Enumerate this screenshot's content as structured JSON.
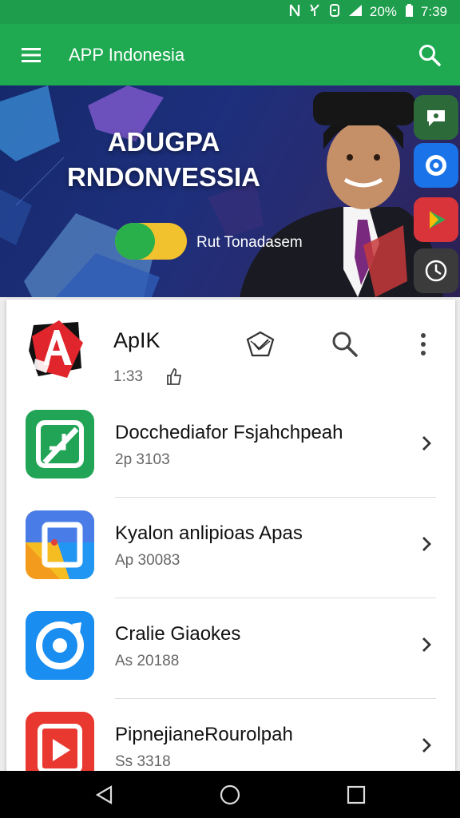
{
  "status_bar": {
    "battery_text": "20%",
    "time": "7:39",
    "icons": [
      "nfc-icon",
      "vibrate-icon",
      "alarm-icon",
      "signal-icon",
      "battery-icon"
    ]
  },
  "app_bar": {
    "title": "APP Indonesia",
    "icons": [
      "hamburger-menu-icon",
      "search-icon"
    ]
  },
  "banner": {
    "title_line1": "ADUGPA",
    "title_line2": "RNDONVESSIA",
    "subtitle": "Rut Tonadasem",
    "side_icons": [
      "chat-icon",
      "target-icon",
      "play-icon",
      "clock-icon"
    ]
  },
  "featured_app": {
    "name": "ApIK",
    "meta": "1:33",
    "icons": [
      "shield-check-icon",
      "search-icon",
      "more-vertical-icon",
      "thumbs-up-icon"
    ]
  },
  "app_list": [
    {
      "name": "Docchediafor Fsjahchpeah",
      "subtitle": "2p 3103",
      "icon": "edit-square-icon"
    },
    {
      "name": "Kyalon anlipioas Apas",
      "subtitle": "Ap 30083",
      "icon": "photos-icon"
    },
    {
      "name": "Cralie Giaokes",
      "subtitle": "As 20188",
      "icon": "compass-icon"
    },
    {
      "name": "PipnejianeRourolpah",
      "subtitle": "Ss 3318",
      "icon": "play-triangle-icon"
    }
  ],
  "colors": {
    "status_bar": "#1e9e4c",
    "app_bar": "#1faa52",
    "banner_bg": "#1d2f7c",
    "toggle_green": "#29b04a",
    "toggle_yellow": "#f2c12e",
    "nav_bar": "#000000"
  },
  "nav_bar": {
    "icons": [
      "back-icon",
      "home-icon",
      "recents-icon"
    ]
  }
}
